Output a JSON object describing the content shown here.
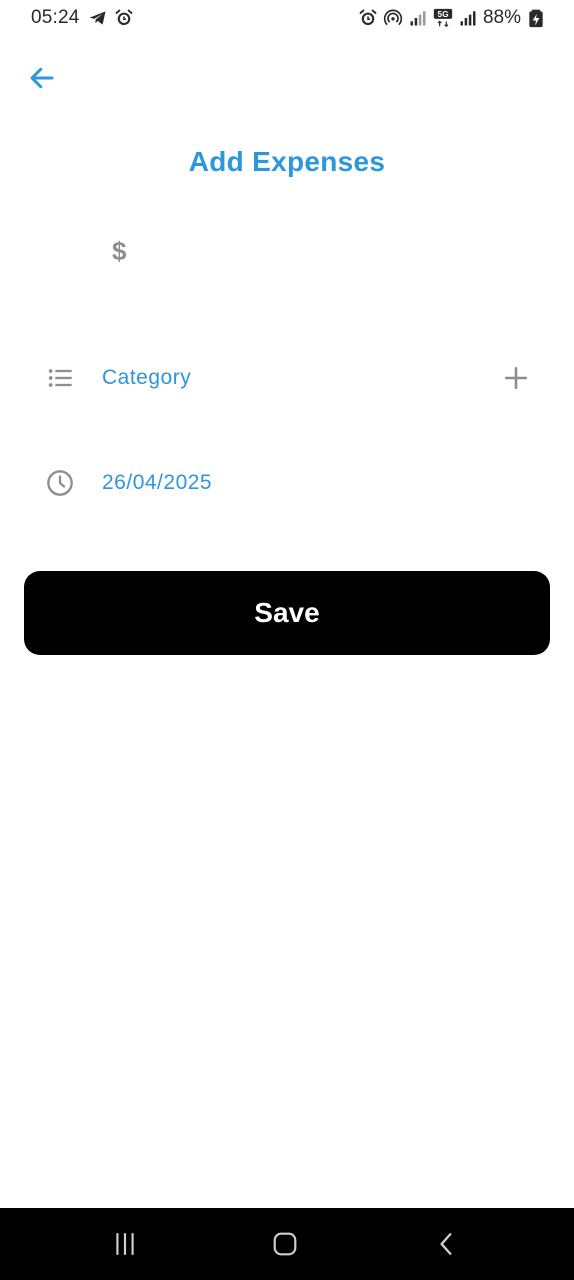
{
  "status_bar": {
    "time": "05:24",
    "battery": "88%",
    "network": "5G",
    "left_icons": [
      "telegram-icon",
      "alarm-icon"
    ],
    "right_icons": [
      "alarm-icon",
      "hotspot-icon",
      "signal-icon",
      "5g-icon",
      "signal-icon",
      "battery-charging-icon"
    ]
  },
  "header": {
    "back_icon": "arrow-left-icon",
    "title": "Add Expenses"
  },
  "form": {
    "amount": {
      "symbol": "$",
      "value": "",
      "placeholder": ""
    },
    "category": {
      "icon": "list-icon",
      "label": "Category",
      "add_icon": "plus-icon"
    },
    "date": {
      "icon": "clock-icon",
      "value": "26/04/2025"
    },
    "save_label": "Save"
  },
  "nav_bar": {
    "items": [
      "recents-icon",
      "home-icon",
      "back-icon"
    ]
  },
  "colors": {
    "accent": "#2c97d9",
    "icon_gray": "#8e8e8e",
    "button_bg": "#000000",
    "button_text": "#ffffff"
  }
}
